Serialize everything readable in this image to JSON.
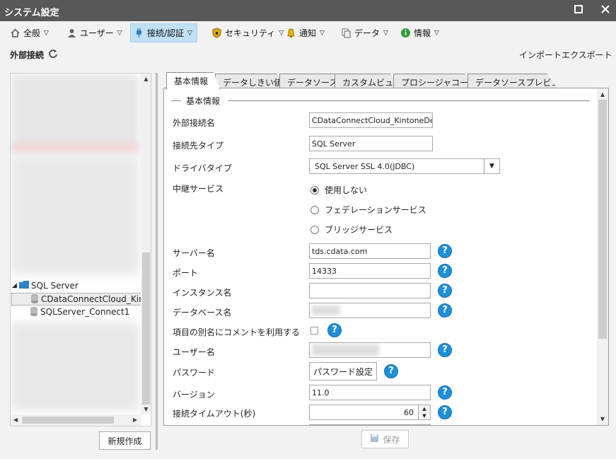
{
  "window": {
    "title": "システム設定",
    "maximize_icon": "maximize-icon",
    "close_icon": "close-icon"
  },
  "menu": [
    {
      "label": "全般",
      "icon": "home-icon"
    },
    {
      "label": "ユーザー",
      "icon": "user-icon"
    },
    {
      "label": "接続/認証",
      "icon": "plug-icon"
    },
    {
      "label": "セキュリティ",
      "icon": "shield-icon"
    },
    {
      "label": "通知",
      "icon": "bell-icon"
    },
    {
      "label": "データ",
      "icon": "data-icon"
    },
    {
      "label": "情報",
      "icon": "info-icon"
    }
  ],
  "subheader": {
    "section": "外部接続",
    "import": "インポート",
    "export": "エクスポート"
  },
  "tree": {
    "items": [
      {
        "label": "SQL Server"
      },
      {
        "label": "CDataConnectCloud_KintoneDemo"
      },
      {
        "label": "SQLServer_Connect1"
      }
    ],
    "new_button": "新規作成"
  },
  "tabs": [
    "基本情報",
    "データしきい値",
    "データソース",
    "カスタムビュー",
    "プロシージャコール",
    "データソースプレビュー"
  ],
  "form": {
    "group_title": "基本情報",
    "ext_name": {
      "label": "外部接続名",
      "value": "CDataConnectCloud_KintoneDemo"
    },
    "conn_type": {
      "label": "接続先タイプ",
      "value": "SQL Server"
    },
    "driver_type": {
      "label": "ドライバタイプ",
      "value": "SQL Server SSL 4.0(JDBC)"
    },
    "relay": {
      "label": "中継サービス",
      "options": [
        "使用しない",
        "フェデレーションサービス",
        "ブリッジサービス"
      ],
      "selected": 0
    },
    "server": {
      "label": "サーバー名",
      "value": "tds.cdata.com"
    },
    "port": {
      "label": "ポート",
      "value": "14333"
    },
    "instance": {
      "label": "インスタンス名",
      "value": ""
    },
    "database": {
      "label": "データベース名",
      "value": ""
    },
    "alias_comment": {
      "label": "項目の別名にコメントを利用する",
      "checked": false
    },
    "username": {
      "label": "ユーザー名",
      "value": ""
    },
    "password": {
      "label": "パスワード",
      "button": "パスワード設定"
    },
    "version": {
      "label": "バージョン",
      "value": "11.0"
    },
    "timeout": {
      "label": "接続タイムアウト(秒)",
      "value": "60"
    },
    "help_glyph": "?"
  },
  "save_button": "保存"
}
